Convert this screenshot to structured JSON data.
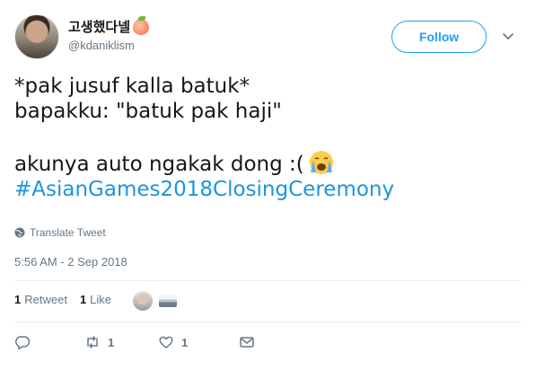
{
  "user": {
    "display_name": "고생했다넬",
    "handle": "@kdaniklism"
  },
  "follow_label": "Follow",
  "tweet": {
    "line1": "*pak jusuf kalla batuk*",
    "line2": "bapakku: \"batuk pak haji\"",
    "line3": "akunya auto ngakak dong :(",
    "hashtag": "#AsianGames2018ClosingCeremony"
  },
  "translate_label": "Translate Tweet",
  "timestamp": "5:56 AM - 2 Sep 2018",
  "stats": {
    "retweet_count": "1",
    "retweet_label": "Retweet",
    "like_count": "1",
    "like_label": "Like"
  },
  "actions": {
    "retweet_count": "1",
    "like_count": "1"
  },
  "colors": {
    "accent": "#1da1f2",
    "hashtag": "#1b95e0",
    "muted": "#657786",
    "text": "#14171a",
    "divider": "#e6ecf0"
  },
  "icons": [
    "reply-icon",
    "retweet-icon",
    "like-icon",
    "message-icon",
    "globe-icon",
    "chevron-down-icon",
    "crying-face-emoji",
    "peach-emoji"
  ]
}
